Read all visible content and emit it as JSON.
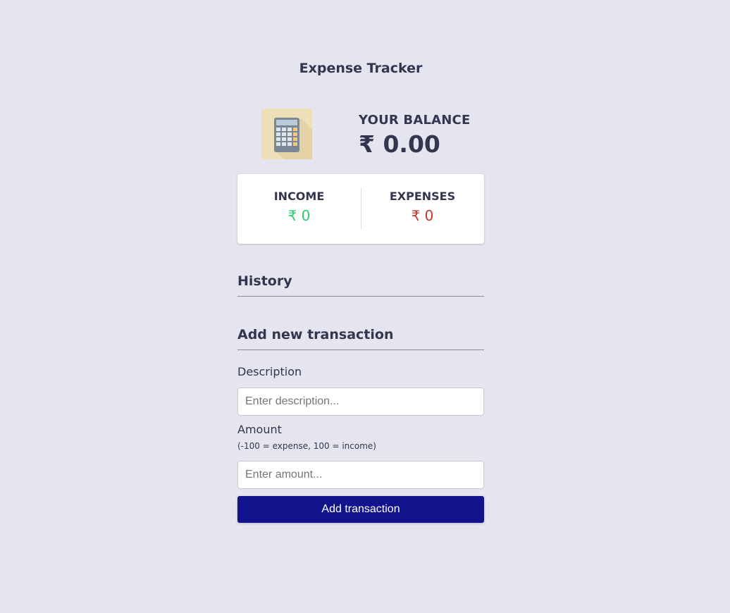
{
  "app": {
    "title": "Expense Tracker"
  },
  "balance": {
    "label": "YOUR BALANCE",
    "value": "₹ 0.00",
    "icon": "calculator-icon"
  },
  "summary": {
    "income_label": "INCOME",
    "income_value": "₹ 0",
    "expense_label": "EXPENSES",
    "expense_value": "₹ 0"
  },
  "history": {
    "heading": "History"
  },
  "form": {
    "heading": "Add new transaction",
    "description_label": "Description",
    "description_placeholder": "Enter description...",
    "amount_label": "Amount",
    "amount_hint": "(-100 = expense, 100 = income)",
    "amount_placeholder": "Enter amount...",
    "submit_label": "Add transaction"
  },
  "colors": {
    "background": "#e4e5ee",
    "income": "#2ecc71",
    "expense": "#c0392b",
    "button": "#11148c"
  }
}
